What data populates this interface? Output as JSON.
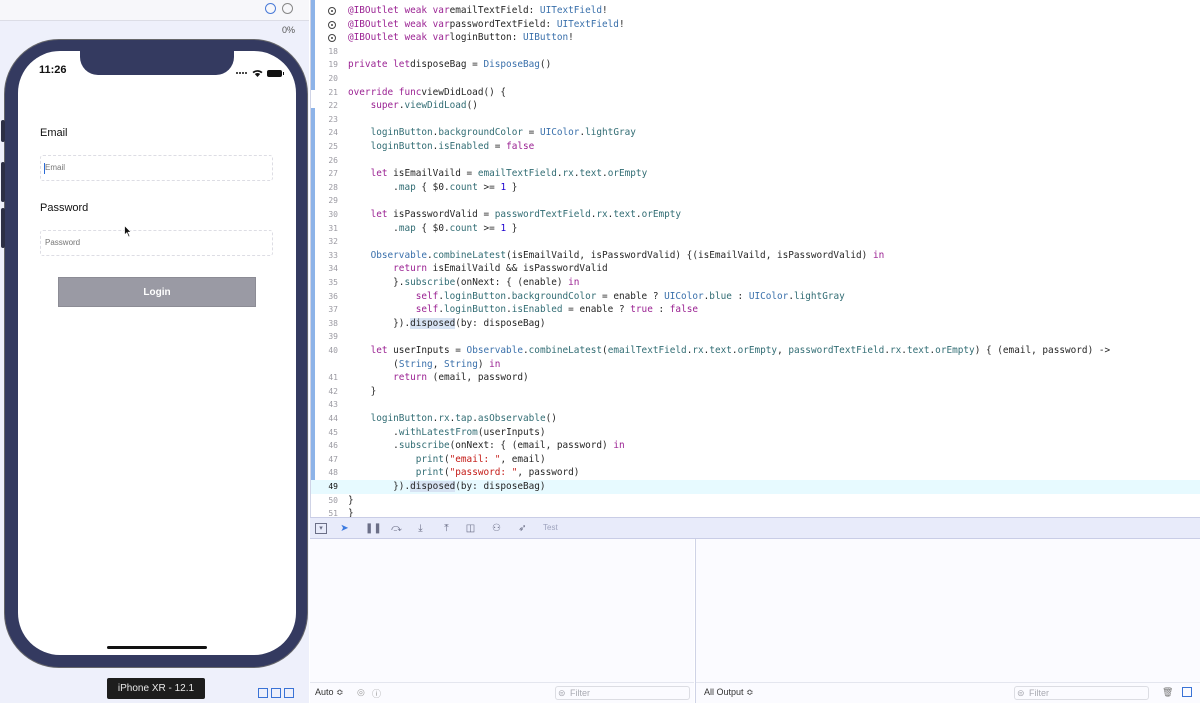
{
  "simulator": {
    "top_percent": "0%",
    "status_time": "11:26",
    "email_label": "Email",
    "email_placeholder": "Email",
    "password_label": "Password",
    "password_placeholder": "Password",
    "login_button": "Login",
    "device_label": "iPhone XR - 12.1"
  },
  "editor": {
    "lines": [
      {
        "n": "",
        "outlet": true,
        "parts": [
          [
            "kw",
            "@IBOutlet weak var"
          ],
          [
            "",
            "emailTextField: "
          ],
          [
            "ty",
            "UITextField"
          ],
          [
            "",
            "!"
          ]
        ]
      },
      {
        "n": "",
        "outlet": true,
        "parts": [
          [
            "kw",
            "@IBOutlet weak var"
          ],
          [
            "",
            "passwordTextField: "
          ],
          [
            "ty",
            "UITextField"
          ],
          [
            "",
            "!"
          ]
        ]
      },
      {
        "n": "",
        "outlet": true,
        "parts": [
          [
            "kw",
            "@IBOutlet weak var"
          ],
          [
            "",
            "loginButton: "
          ],
          [
            "ty",
            "UIButton"
          ],
          [
            "",
            "!"
          ]
        ]
      },
      {
        "n": "18",
        "parts": []
      },
      {
        "n": "19",
        "parts": [
          [
            "kw",
            "private let"
          ],
          [
            "",
            "disposeBag = "
          ],
          [
            "ty",
            "DisposeBag"
          ],
          [
            "",
            "()"
          ]
        ]
      },
      {
        "n": "20",
        "parts": []
      },
      {
        "n": "21",
        "parts": [
          [
            "kw",
            "override func"
          ],
          [
            "",
            "viewDidLoad() {"
          ]
        ]
      },
      {
        "n": "22",
        "parts": [
          [
            "",
            "    "
          ],
          [
            "kw",
            "super"
          ],
          [
            "",
            "."
          ],
          [
            "fn",
            "viewDidLoad"
          ],
          [
            "",
            "()"
          ]
        ]
      },
      {
        "n": "23",
        "parts": []
      },
      {
        "n": "24",
        "parts": [
          [
            "",
            "    "
          ],
          [
            "fn",
            "loginButton"
          ],
          [
            "",
            "."
          ],
          [
            "fn",
            "backgroundColor"
          ],
          [
            "",
            " = "
          ],
          [
            "ty",
            "UIColor"
          ],
          [
            "",
            "."
          ],
          [
            "fn",
            "lightGray"
          ]
        ]
      },
      {
        "n": "25",
        "parts": [
          [
            "",
            "    "
          ],
          [
            "fn",
            "loginButton"
          ],
          [
            "",
            "."
          ],
          [
            "fn",
            "isEnabled"
          ],
          [
            "",
            " = "
          ],
          [
            "kw",
            "false"
          ]
        ]
      },
      {
        "n": "26",
        "parts": []
      },
      {
        "n": "27",
        "parts": [
          [
            "",
            "    "
          ],
          [
            "kw",
            "let"
          ],
          [
            "",
            " isEmailVaild = "
          ],
          [
            "fn",
            "emailTextField"
          ],
          [
            "",
            "."
          ],
          [
            "fn",
            "rx"
          ],
          [
            "",
            "."
          ],
          [
            "fn",
            "text"
          ],
          [
            "",
            "."
          ],
          [
            "fn",
            "orEmpty"
          ]
        ]
      },
      {
        "n": "28",
        "parts": [
          [
            "",
            "        ."
          ],
          [
            "fn",
            "map"
          ],
          [
            "",
            " { $0."
          ],
          [
            "fn",
            "count"
          ],
          [
            "",
            " >= "
          ],
          [
            "num",
            "1"
          ],
          [
            "",
            " }"
          ]
        ]
      },
      {
        "n": "29",
        "parts": []
      },
      {
        "n": "30",
        "parts": [
          [
            "",
            "    "
          ],
          [
            "kw",
            "let"
          ],
          [
            "",
            " isPasswordValid = "
          ],
          [
            "fn",
            "passwordTextField"
          ],
          [
            "",
            "."
          ],
          [
            "fn",
            "rx"
          ],
          [
            "",
            "."
          ],
          [
            "fn",
            "text"
          ],
          [
            "",
            "."
          ],
          [
            "fn",
            "orEmpty"
          ]
        ]
      },
      {
        "n": "31",
        "parts": [
          [
            "",
            "        ."
          ],
          [
            "fn",
            "map"
          ],
          [
            "",
            " { $0."
          ],
          [
            "fn",
            "count"
          ],
          [
            "",
            " >= "
          ],
          [
            "num",
            "1"
          ],
          [
            "",
            " }"
          ]
        ]
      },
      {
        "n": "32",
        "parts": []
      },
      {
        "n": "33",
        "parts": [
          [
            "",
            "    "
          ],
          [
            "ty",
            "Observable"
          ],
          [
            "",
            "."
          ],
          [
            "fn",
            "combineLatest"
          ],
          [
            "",
            "(isEmailVaild, isPasswordValid) {(isEmailVaild, isPasswordValid) "
          ],
          [
            "kw",
            "in"
          ]
        ]
      },
      {
        "n": "34",
        "parts": [
          [
            "",
            "        "
          ],
          [
            "kw",
            "return"
          ],
          [
            "",
            " isEmailVaild && isPasswordValid"
          ]
        ]
      },
      {
        "n": "35",
        "parts": [
          [
            "",
            "        }."
          ],
          [
            "fn",
            "subscribe"
          ],
          [
            "",
            "(onNext: { (enable) "
          ],
          [
            "kw",
            "in"
          ]
        ]
      },
      {
        "n": "36",
        "parts": [
          [
            "",
            "            "
          ],
          [
            "kw",
            "self"
          ],
          [
            "",
            "."
          ],
          [
            "fn",
            "loginButton"
          ],
          [
            "",
            "."
          ],
          [
            "fn",
            "backgroundColor"
          ],
          [
            "",
            " = enable ? "
          ],
          [
            "ty",
            "UIColor"
          ],
          [
            "",
            "."
          ],
          [
            "fn",
            "blue"
          ],
          [
            "",
            " : "
          ],
          [
            "ty",
            "UIColor"
          ],
          [
            "",
            "."
          ],
          [
            "fn",
            "lightGray"
          ]
        ]
      },
      {
        "n": "37",
        "parts": [
          [
            "",
            "            "
          ],
          [
            "kw",
            "self"
          ],
          [
            "",
            "."
          ],
          [
            "fn",
            "loginButton"
          ],
          [
            "",
            "."
          ],
          [
            "fn",
            "isEnabled"
          ],
          [
            "",
            " = enable ? "
          ],
          [
            "kw",
            "true"
          ],
          [
            "",
            " : "
          ],
          [
            "kw",
            "false"
          ]
        ]
      },
      {
        "n": "38",
        "parts": [
          [
            "",
            "        })."
          ],
          [
            "sel",
            "disposed"
          ],
          [
            "",
            "(by: disposeBag)"
          ]
        ]
      },
      {
        "n": "39",
        "parts": []
      },
      {
        "n": "40",
        "parts": [
          [
            "",
            "    "
          ],
          [
            "kw",
            "let"
          ],
          [
            "",
            " userInputs = "
          ],
          [
            "ty",
            "Observable"
          ],
          [
            "",
            "."
          ],
          [
            "fn",
            "combineLatest"
          ],
          [
            "",
            "("
          ],
          [
            "fn",
            "emailTextField"
          ],
          [
            "",
            "."
          ],
          [
            "fn",
            "rx"
          ],
          [
            "",
            "."
          ],
          [
            "fn",
            "text"
          ],
          [
            "",
            "."
          ],
          [
            "fn",
            "orEmpty"
          ],
          [
            "",
            ", "
          ],
          [
            "fn",
            "passwordTextField"
          ],
          [
            "",
            "."
          ],
          [
            "fn",
            "rx"
          ],
          [
            "",
            "."
          ],
          [
            "fn",
            "text"
          ],
          [
            "",
            "."
          ],
          [
            "fn",
            "orEmpty"
          ],
          [
            "",
            ") { (email, password) ->"
          ]
        ]
      },
      {
        "n": "",
        "parts": [
          [
            "",
            "        ("
          ],
          [
            "ty",
            "String"
          ],
          [
            "",
            ", "
          ],
          [
            "ty",
            "String"
          ],
          [
            "",
            ") "
          ],
          [
            "kw",
            "in"
          ]
        ]
      },
      {
        "n": "41",
        "parts": [
          [
            "",
            "        "
          ],
          [
            "kw",
            "return"
          ],
          [
            "",
            " (email, password)"
          ]
        ]
      },
      {
        "n": "42",
        "parts": [
          [
            "",
            "    }"
          ]
        ]
      },
      {
        "n": "43",
        "parts": []
      },
      {
        "n": "44",
        "parts": [
          [
            "",
            "    "
          ],
          [
            "fn",
            "loginButton"
          ],
          [
            "",
            "."
          ],
          [
            "fn",
            "rx"
          ],
          [
            "",
            "."
          ],
          [
            "fn",
            "tap"
          ],
          [
            "",
            "."
          ],
          [
            "fn",
            "asObservable"
          ],
          [
            "",
            "()"
          ]
        ]
      },
      {
        "n": "45",
        "parts": [
          [
            "",
            "        ."
          ],
          [
            "fn",
            "withLatestFrom"
          ],
          [
            "",
            "(userInputs)"
          ]
        ]
      },
      {
        "n": "46",
        "parts": [
          [
            "",
            "        ."
          ],
          [
            "fn",
            "subscribe"
          ],
          [
            "",
            "(onNext: { (email, password) "
          ],
          [
            "kw",
            "in"
          ]
        ]
      },
      {
        "n": "47",
        "parts": [
          [
            "",
            "            "
          ],
          [
            "fn",
            "print"
          ],
          [
            "",
            "("
          ],
          [
            "str",
            "\"email: \""
          ],
          [
            "",
            ", email)"
          ]
        ]
      },
      {
        "n": "48",
        "parts": [
          [
            "",
            "            "
          ],
          [
            "fn",
            "print"
          ],
          [
            "",
            "("
          ],
          [
            "str",
            "\"password: \""
          ],
          [
            "",
            ", password)"
          ]
        ]
      },
      {
        "n": "49",
        "current": true,
        "parts": [
          [
            "",
            "        })."
          ],
          [
            "sel",
            "disposed"
          ],
          [
            "",
            "(by: disposeBag)"
          ]
        ]
      },
      {
        "n": "50",
        "parts": [
          [
            "",
            "}"
          ]
        ]
      },
      {
        "n": "51",
        "parts": [
          [
            "",
            "}"
          ]
        ]
      }
    ]
  },
  "debug_bar": {
    "thread_label": "Test"
  },
  "variables_pane": {
    "scope": "Auto ≎",
    "filter_placeholder": "Filter"
  },
  "console_pane": {
    "output": "All Output ≎",
    "filter_placeholder": "Filter"
  }
}
